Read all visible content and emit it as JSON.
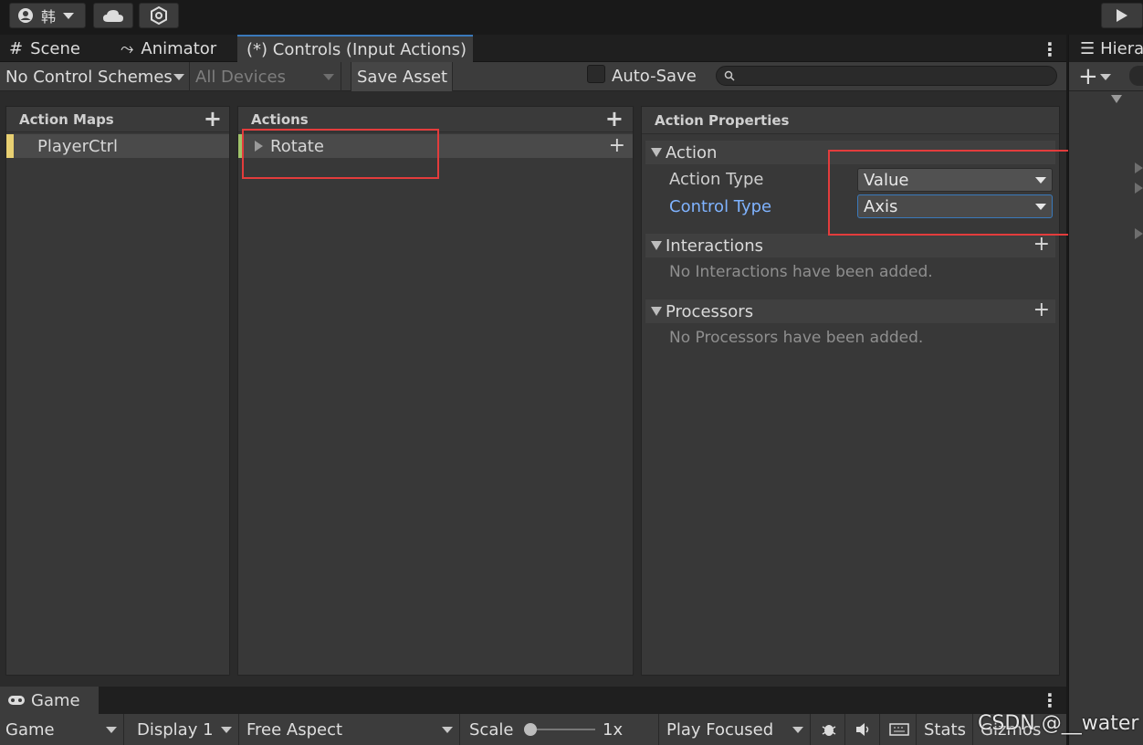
{
  "topbar": {
    "account_glyph": "韩",
    "account_icon": "user-circle-icon",
    "cloud_icon": "cloud-icon",
    "collab_icon": "collab-icon",
    "play_icon": "play-icon"
  },
  "tabs": [
    {
      "icon": "#",
      "label": "Scene"
    },
    {
      "icon": "⤳",
      "label": "Animator"
    },
    {
      "icon": "",
      "label": "(*) Controls (Input Actions)"
    }
  ],
  "toolbar": {
    "control_schemes": "No Control Schemes",
    "devices": "All Devices",
    "save_asset": "Save Asset",
    "auto_save": "Auto-Save"
  },
  "action_maps": {
    "header": "Action Maps",
    "items": [
      "PlayerCtrl"
    ]
  },
  "actions": {
    "header": "Actions",
    "items": [
      "Rotate"
    ]
  },
  "properties": {
    "header": "Action Properties",
    "action_section": "Action",
    "action_type_label": "Action Type",
    "action_type_value": "Value",
    "control_type_label": "Control Type",
    "control_type_value": "Axis",
    "interactions_section": "Interactions",
    "interactions_empty": "No Interactions have been added.",
    "processors_section": "Processors",
    "processors_empty": "No Processors have been added."
  },
  "game": {
    "tab_label": "Game",
    "view": "Game",
    "display": "Display 1",
    "aspect": "Free Aspect",
    "scale_label": "Scale",
    "scale_value": "1x",
    "play_mode": "Play Focused",
    "stats": "Stats",
    "gizmos": "Gizmos"
  },
  "hierarchy": {
    "tab_label": "Hiera"
  },
  "watermark": "CSDN @__water",
  "colors": {
    "accent_blue": "#3a79bb",
    "highlight_text": "#7fb3ff",
    "annotation_red": "#e33c3c",
    "map_marker": "#e8d072",
    "action_marker": "#9fc26a"
  }
}
